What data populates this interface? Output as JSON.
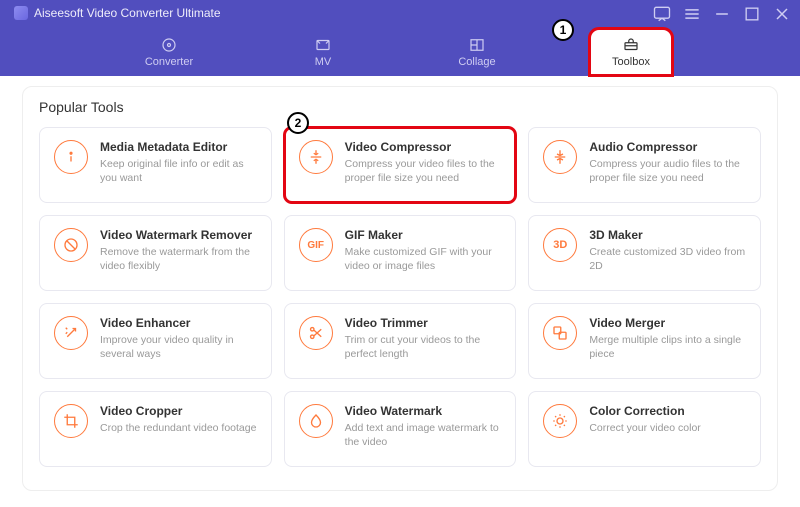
{
  "app": {
    "title": "Aiseesoft Video Converter Ultimate"
  },
  "nav": {
    "items": [
      {
        "label": "Converter",
        "icon": "converter-icon"
      },
      {
        "label": "MV",
        "icon": "mv-icon"
      },
      {
        "label": "Collage",
        "icon": "collage-icon"
      },
      {
        "label": "Toolbox",
        "icon": "toolbox-icon"
      }
    ],
    "active_index": 3
  },
  "section": {
    "heading": "Popular Tools"
  },
  "tools": [
    {
      "title": "Media Metadata Editor",
      "desc": "Keep original file info or edit as you want"
    },
    {
      "title": "Video Compressor",
      "desc": "Compress your video files to the proper file size you need"
    },
    {
      "title": "Audio Compressor",
      "desc": "Compress your audio files to the proper file size you need"
    },
    {
      "title": "Video Watermark Remover",
      "desc": "Remove the watermark from the video flexibly"
    },
    {
      "title": "GIF Maker",
      "desc": "Make customized GIF with your video or image files"
    },
    {
      "title": "3D Maker",
      "desc": "Create customized 3D video from 2D"
    },
    {
      "title": "Video Enhancer",
      "desc": "Improve your video quality in several ways"
    },
    {
      "title": "Video Trimmer",
      "desc": "Trim or cut your videos to the perfect length"
    },
    {
      "title": "Video Merger",
      "desc": "Merge multiple clips into a single piece"
    },
    {
      "title": "Video Cropper",
      "desc": "Crop the redundant video footage"
    },
    {
      "title": "Video Watermark",
      "desc": "Add text and image watermark to the video"
    },
    {
      "title": "Color Correction",
      "desc": "Correct your video color"
    }
  ],
  "callouts": {
    "step1": "1",
    "step2": "2"
  },
  "highlight": {
    "nav_index": 3,
    "tool_index": 1
  }
}
